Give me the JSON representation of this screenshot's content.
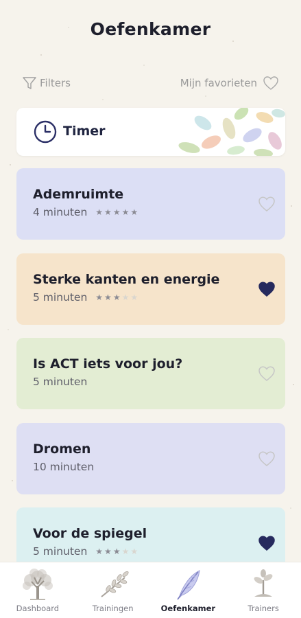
{
  "header": {
    "title": "Oefenkamer"
  },
  "toolbar": {
    "filters_label": "Filters",
    "favorites_label": "Mijn favorieten"
  },
  "timer": {
    "label": "Timer"
  },
  "exercises": [
    {
      "title": "Ademruimte",
      "duration": "4 minuten",
      "rating": 5,
      "rating_max": 5,
      "favorite": false,
      "color": "#dcdff5"
    },
    {
      "title": "Sterke kanten en energie",
      "duration": "5 minuten",
      "rating": 3,
      "rating_max": 4,
      "favorite": true,
      "color": "#f6e4cb"
    },
    {
      "title": "Is ACT iets voor jou?",
      "duration": "5 minuten",
      "rating": null,
      "favorite": false,
      "color": "#e3edd3"
    },
    {
      "title": "Dromen",
      "duration": "10 minuten",
      "rating": null,
      "favorite": false,
      "color": "#dedff3"
    },
    {
      "title": "Voor de spiegel",
      "duration": "5 minuten",
      "rating": 3,
      "rating_max": 4,
      "favorite": true,
      "color": "#dcf0f1"
    }
  ],
  "nav": {
    "items": [
      {
        "label": "Dashboard",
        "icon": "tree-icon",
        "active": false
      },
      {
        "label": "Trainingen",
        "icon": "branch-icon",
        "active": false
      },
      {
        "label": "Oefenkamer",
        "icon": "feather-icon",
        "active": true
      },
      {
        "label": "Trainers",
        "icon": "sprout-icon",
        "active": false
      }
    ]
  },
  "colors": {
    "accent_dark": "#2b2f66",
    "background": "#f6f3ec",
    "heart_filled": "#262a5e",
    "heart_outline": "#c9c9c9"
  }
}
